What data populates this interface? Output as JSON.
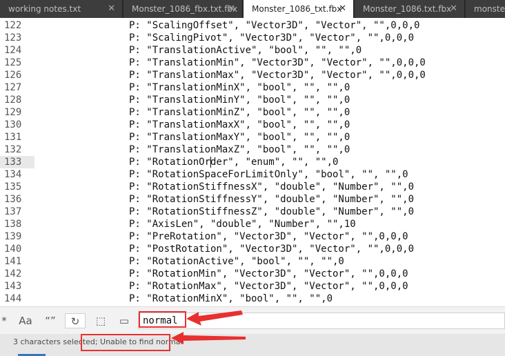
{
  "tabs": [
    {
      "label": "working notes.txt",
      "close": "✕"
    },
    {
      "label": "Monster_1086_fbx.txt.fbx",
      "close": "✕"
    },
    {
      "label": "Monster_1086_txt.fbx",
      "close": "✕"
    },
    {
      "label": "Monster_1086.txt.fbx",
      "close": "✕"
    },
    {
      "label": "monster_",
      "close": ""
    }
  ],
  "editor": {
    "lines": [
      {
        "num": "122",
        "code": "P: \"ScalingOffset\", \"Vector3D\", \"Vector\", \"\",0,0,0"
      },
      {
        "num": "123",
        "code": "P: \"ScalingPivot\", \"Vector3D\", \"Vector\", \"\",0,0,0"
      },
      {
        "num": "124",
        "code": "P: \"TranslationActive\", \"bool\", \"\", \"\",0"
      },
      {
        "num": "125",
        "code": "P: \"TranslationMin\", \"Vector3D\", \"Vector\", \"\",0,0,0"
      },
      {
        "num": "126",
        "code": "P: \"TranslationMax\", \"Vector3D\", \"Vector\", \"\",0,0,0"
      },
      {
        "num": "127",
        "code": "P: \"TranslationMinX\", \"bool\", \"\", \"\",0"
      },
      {
        "num": "128",
        "code": "P: \"TranslationMinY\", \"bool\", \"\", \"\",0"
      },
      {
        "num": "129",
        "code": "P: \"TranslationMinZ\", \"bool\", \"\", \"\",0"
      },
      {
        "num": "130",
        "code": "P: \"TranslationMaxX\", \"bool\", \"\", \"\",0"
      },
      {
        "num": "131",
        "code": "P: \"TranslationMaxY\", \"bool\", \"\", \"\",0"
      },
      {
        "num": "132",
        "code": "P: \"TranslationMaxZ\", \"bool\", \"\", \"\",0"
      },
      {
        "num": "133",
        "code": "P: \"RotationOrder\", \"enum\", \"\", \"\",0"
      },
      {
        "num": "134",
        "code": "P: \"RotationSpaceForLimitOnly\", \"bool\", \"\", \"\",0"
      },
      {
        "num": "135",
        "code": "P: \"RotationStiffnessX\", \"double\", \"Number\", \"\",0"
      },
      {
        "num": "136",
        "code": "P: \"RotationStiffnessY\", \"double\", \"Number\", \"\",0"
      },
      {
        "num": "137",
        "code": "P: \"RotationStiffnessZ\", \"double\", \"Number\", \"\",0"
      },
      {
        "num": "138",
        "code": "P: \"AxisLen\", \"double\", \"Number\", \"\",10"
      },
      {
        "num": "139",
        "code": "P: \"PreRotation\", \"Vector3D\", \"Vector\", \"\",0,0,0"
      },
      {
        "num": "140",
        "code": "P: \"PostRotation\", \"Vector3D\", \"Vector\", \"\",0,0,0"
      },
      {
        "num": "141",
        "code": "P: \"RotationActive\", \"bool\", \"\", \"\",0"
      },
      {
        "num": "142",
        "code": "P: \"RotationMin\", \"Vector3D\", \"Vector\", \"\",0,0,0"
      },
      {
        "num": "143",
        "code": "P: \"RotationMax\", \"Vector3D\", \"Vector\", \"\",0,0,0"
      },
      {
        "num": "144",
        "code": "P: \"RotationMinX\", \"bool\", \"\", \"\",0"
      }
    ],
    "current_line": "133"
  },
  "findbar": {
    "regex_label": "*",
    "case_label": "Aa",
    "whole_word_label": "“”",
    "wrap_label": "↻",
    "selection_label": "⬚",
    "highlight_label": "▭",
    "input_value": "normal"
  },
  "status": {
    "text": "3 characters selected; Unable to find normal"
  },
  "colors": {
    "annotation": "#e83030",
    "tab_bar": "#2b2b2b",
    "status_accent": "#3a73b8"
  }
}
